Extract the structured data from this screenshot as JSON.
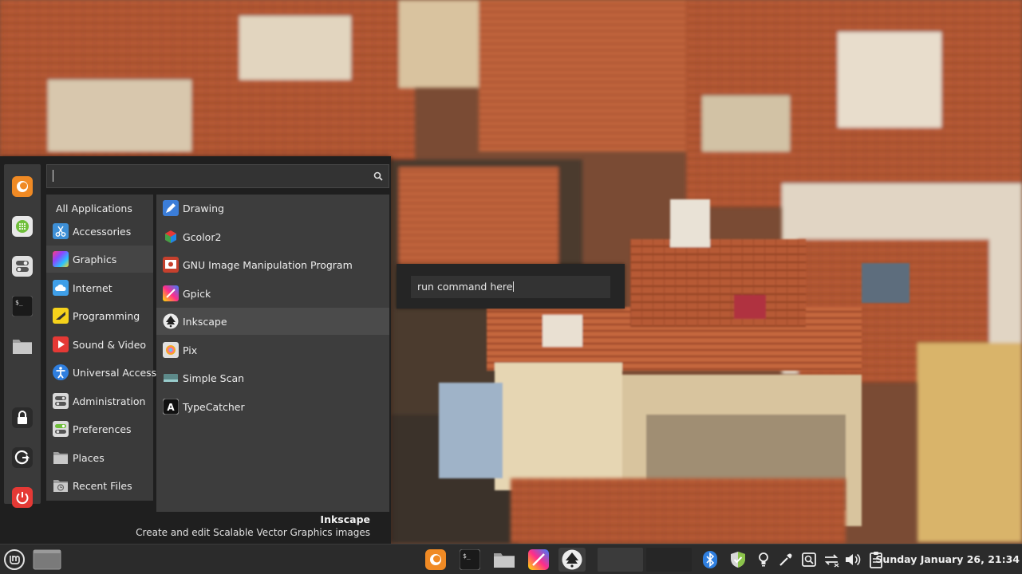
{
  "menu": {
    "favorites": [
      {
        "name": "Firefox",
        "icon": "firefox-icon"
      },
      {
        "name": "Software Manager",
        "icon": "software-manager-icon"
      },
      {
        "name": "System Settings",
        "icon": "settings-toggle-icon"
      },
      {
        "name": "Terminal",
        "icon": "terminal-icon"
      },
      {
        "name": "Files",
        "icon": "folder-icon"
      },
      {
        "name": "Lock Screen",
        "icon": "lock-icon"
      },
      {
        "name": "Log Out",
        "icon": "logout-icon"
      },
      {
        "name": "Shut Down",
        "icon": "power-icon"
      }
    ],
    "search": {
      "value": "",
      "placeholder": ""
    },
    "categories": [
      {
        "label": "All Applications",
        "icon": ""
      },
      {
        "label": "Accessories",
        "icon": "scissors-icon"
      },
      {
        "label": "Graphics",
        "icon": "graphics-icon"
      },
      {
        "label": "Internet",
        "icon": "cloud-icon"
      },
      {
        "label": "Programming",
        "icon": "programming-icon"
      },
      {
        "label": "Sound & Video",
        "icon": "play-icon"
      },
      {
        "label": "Universal Access",
        "icon": "accessibility-icon"
      },
      {
        "label": "Administration",
        "icon": "administration-icon"
      },
      {
        "label": "Preferences",
        "icon": "preferences-icon"
      },
      {
        "label": "Places",
        "icon": "folder-icon"
      },
      {
        "label": "Recent Files",
        "icon": "recent-files-icon"
      }
    ],
    "active_category": "Graphics",
    "apps": [
      {
        "label": "Drawing",
        "icon": "drawing-icon"
      },
      {
        "label": "Gcolor2",
        "icon": "gcolor2-icon"
      },
      {
        "label": "GNU Image Manipulation Program",
        "icon": "gimp-icon"
      },
      {
        "label": "Gpick",
        "icon": "gpick-icon"
      },
      {
        "label": "Inkscape",
        "icon": "inkscape-icon"
      },
      {
        "label": "Pix",
        "icon": "pix-icon"
      },
      {
        "label": "Simple Scan",
        "icon": "scanner-icon"
      },
      {
        "label": "TypeCatcher",
        "icon": "typecatcher-icon"
      }
    ],
    "hovered_app": "Inkscape",
    "description": {
      "title": "Inkscape",
      "text": "Create and edit Scalable Vector Graphics images"
    }
  },
  "run_dialog": {
    "value": "run command here"
  },
  "panel": {
    "menu_button_icon": "mint-logo-icon",
    "launchers": [
      "firefox-icon",
      "terminal-icon",
      "folder-icon",
      "gpick-icon",
      "inkscape-icon"
    ],
    "tray_icons": [
      "bluetooth-icon",
      "update-shield-icon",
      "redshift-bulb-icon",
      "color-picker-icon",
      "screenshot-icon",
      "network-icon",
      "volume-icon",
      "clipboard-icon"
    ],
    "clock": "Sunday January 26, 21:34"
  },
  "colors": {
    "menu_bg": "#1f1f1f",
    "rail_bg": "#3a3a3a",
    "panel_bg": "#2b2b2b",
    "power_red": "#e53935",
    "firefox_orange": "#f08a24",
    "mint_green": "#8bc34a"
  }
}
